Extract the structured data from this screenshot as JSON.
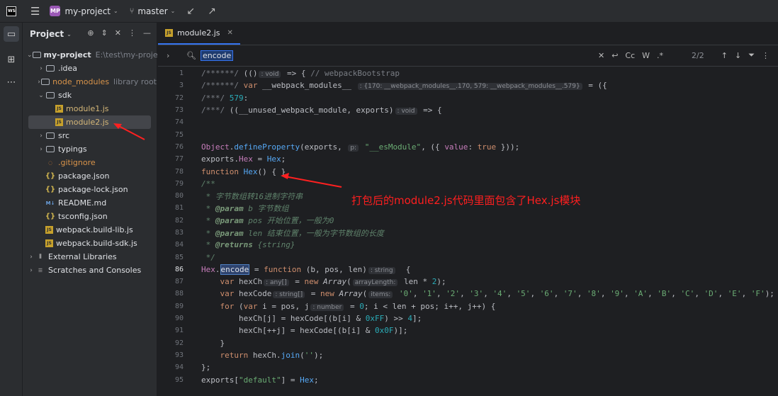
{
  "titlebar": {
    "project_badge": "MP",
    "project_name": "my-project",
    "branch": "master"
  },
  "panel": {
    "title": "Project",
    "tree": [
      {
        "label": "my-project",
        "path": "E:\\test\\my-project",
        "type": "folder",
        "depth": 0,
        "expanded": true,
        "bold": true
      },
      {
        "label": ".idea",
        "type": "folder",
        "depth": 1
      },
      {
        "label": "node_modules",
        "extra": "library root",
        "type": "folder",
        "depth": 1,
        "color": "#d9944a"
      },
      {
        "label": "sdk",
        "type": "folder",
        "depth": 1,
        "expanded": true
      },
      {
        "label": "module1.js",
        "type": "js",
        "depth": 2
      },
      {
        "label": "module2.js",
        "type": "js",
        "depth": 2,
        "selected": true
      },
      {
        "label": "src",
        "type": "folder",
        "depth": 1
      },
      {
        "label": "typings",
        "type": "folder",
        "depth": 1
      },
      {
        "label": ".gitignore",
        "type": "gitignore",
        "depth": 1
      },
      {
        "label": "package.json",
        "type": "json",
        "depth": 1
      },
      {
        "label": "package-lock.json",
        "type": "json",
        "depth": 1
      },
      {
        "label": "README.md",
        "type": "md",
        "depth": 1
      },
      {
        "label": "tsconfig.json",
        "type": "json",
        "depth": 1
      },
      {
        "label": "webpack.build-lib.js",
        "type": "js",
        "depth": 1
      },
      {
        "label": "webpack.build-sdk.js",
        "type": "js",
        "depth": 1
      },
      {
        "label": "External Libraries",
        "type": "lib",
        "depth": 0
      },
      {
        "label": "Scratches and Consoles",
        "type": "scratch",
        "depth": 0
      }
    ]
  },
  "editor": {
    "tab": "module2.js",
    "find": {
      "query": "encode",
      "count": "2/2",
      "case": "Cc",
      "word": "W",
      "regex": ".*"
    },
    "lines": [
      {
        "n": "1",
        "html": "<span class='cm'>/******/ </span>(()<span class='hint'>: void</span> => { <span class='cm'>// webpackBootstrap</span>"
      },
      {
        "n": "3",
        "html": "<span class='cm'>/******/ </span><span class='kw'>var</span> __webpack_modules__ <span class='hint'>: {170: __webpack_modules__.170, 579: __webpack_modules__.579}</span> = ({"
      },
      {
        "n": "72",
        "html": "<span class='cm'>/***/ </span><span class='num'>579</span>:"
      },
      {
        "n": "73",
        "html": "<span class='cm'>/***/ </span>((__unused_webpack_module, exports)<span class='hint'>: void</span> => {"
      },
      {
        "n": "74",
        "html": ""
      },
      {
        "n": "75",
        "html": ""
      },
      {
        "n": "76",
        "html": "<span class='prop'>Object</span>.<span class='fn'>defineProperty</span>(exports, <span class='hint'>p:</span> <span class='str'>\"__esModule\"</span>, ({ <span class='prop'>value</span>: <span class='kw'>true</span> }));"
      },
      {
        "n": "77",
        "html": "exports.<span class='prop'>Hex</span> = <span class='fn'>Hex</span>;"
      },
      {
        "n": "78",
        "html": "<span class='kw'>function</span> <span class='fn'>Hex</span>() { }"
      },
      {
        "n": "79",
        "html": "<span class='cmi'>/**</span>"
      },
      {
        "n": "80",
        "html": "<span class='cmi'> * 字节数组转16进制字符串</span>"
      },
      {
        "n": "81",
        "html": "<span class='cmi'> * <b style='color:#7a9a7a'>@param</b> b 字节数组</span>"
      },
      {
        "n": "82",
        "html": "<span class='cmi'> * <b style='color:#7a9a7a'>@param</b> pos 开始位置，一般为0</span>"
      },
      {
        "n": "83",
        "html": "<span class='cmi'> * <b style='color:#7a9a7a'>@param</b> len 结束位置，一般为字节数组的长度</span>"
      },
      {
        "n": "84",
        "html": "<span class='cmi'> * <b style='color:#7a9a7a'>@returns</b> {string}</span>"
      },
      {
        "n": "85",
        "html": "<span class='cmi'> */</span>"
      },
      {
        "n": "86",
        "cur": true,
        "html": "<span class='prop'>Hex</span>.<span class='hl'>encode</span> = <span class='kw'>function</span> (b, pos, len)<span class='hint'>: string</span>  {"
      },
      {
        "n": "87",
        "html": "    <span class='kw'>var</span> hexCh<span class='hint'>: any[]</span> = <span class='kw'>new</span> <i>Array</i>(<span class='hint'>arrayLength:</span> len * <span class='num'>2</span>);"
      },
      {
        "n": "88",
        "html": "    <span class='kw'>var</span> hexCode<span class='hint'>: string[]</span> = <span class='kw'>new</span> <i>Array</i>(<span class='hint'>items:</span> <span class='str'>'0'</span>, <span class='str'>'1'</span>, <span class='str'>'2'</span>, <span class='str'>'3'</span>, <span class='str'>'4'</span>, <span class='str'>'5'</span>, <span class='str'>'6'</span>, <span class='str'>'7'</span>, <span class='str'>'8'</span>, <span class='str'>'9'</span>, <span class='str'>'A'</span>, <span class='str'>'B'</span>, <span class='str'>'C'</span>, <span class='str'>'D'</span>, <span class='str'>'E'</span>, <span class='str'>'F'</span>);"
      },
      {
        "n": "89",
        "html": "    <span class='kw'>for</span> (<span class='kw'>var</span> i = pos, j<span class='hint'>: number</span> = <span class='num'>0</span>; i &lt; len + pos; i++, j++) {"
      },
      {
        "n": "90",
        "html": "        hexCh[j] = hexCode[(b[i] &amp; <span class='num'>0xFF</span>) &gt;&gt; <span class='num'>4</span>];"
      },
      {
        "n": "91",
        "html": "        hexCh[++j] = hexCode[(b[i] &amp; <span class='num'>0x0F</span>)];"
      },
      {
        "n": "92",
        "html": "    }"
      },
      {
        "n": "93",
        "html": "    <span class='kw'>return</span> hexCh.<span class='fn'>join</span>(<span class='str'>''</span>);"
      },
      {
        "n": "94",
        "html": "};"
      },
      {
        "n": "95",
        "html": "exports[<span class='str'>\"default\"</span>] = <span class='fn'>Hex</span>;"
      }
    ]
  },
  "annotation": "打包后的module2.js代码里面包含了Hex.js模块"
}
